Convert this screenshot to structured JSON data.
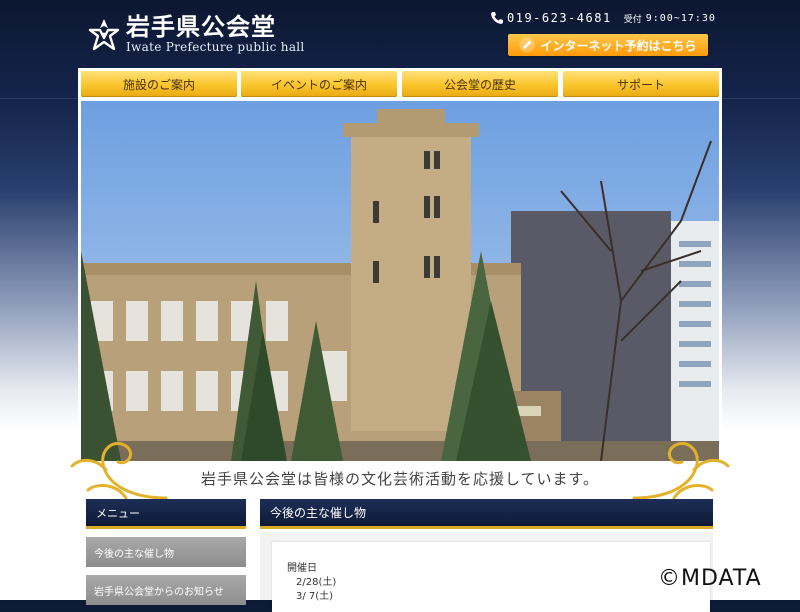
{
  "header": {
    "logo_jp": "岩手県公会堂",
    "logo_en": "Iwate Prefecture public hall",
    "phone": "019-623-4681",
    "hours_label": "受付",
    "hours": "9:00~17:30",
    "reserve_label": "インターネット予約はこちら"
  },
  "nav": {
    "items": [
      {
        "label": "施設のご案内"
      },
      {
        "label": "イベントのご案内"
      },
      {
        "label": "公会堂の歴史"
      },
      {
        "label": "サポート"
      }
    ]
  },
  "hero": {
    "tagline": "岩手県公会堂は皆様の文化芸術活動を応援しています。"
  },
  "sidebar": {
    "title": "メニュー",
    "items": [
      {
        "label": "今後の主な催し物"
      },
      {
        "label": "岩手県公会堂からのお知らせ"
      }
    ]
  },
  "main": {
    "title": "今後の主な催し物",
    "event_label": "開催日",
    "dates": [
      "2/28(土)",
      "3/ 7(土)"
    ]
  },
  "watermark": "©MDATA",
  "colors": {
    "navy": "#14244b",
    "gold": "#fac52a",
    "orange": "#ff9a0a",
    "sidebar_gray": "#9b9b9b"
  }
}
